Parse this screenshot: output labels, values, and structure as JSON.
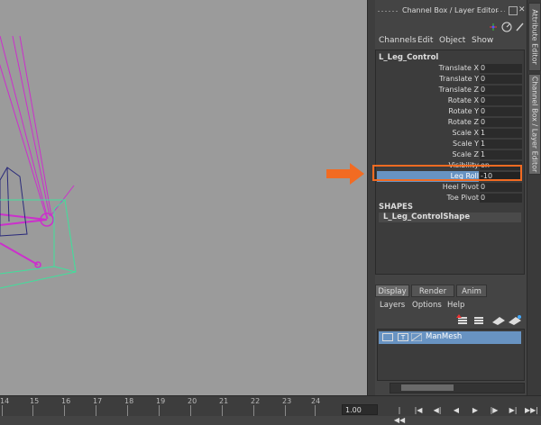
{
  "channel_box": {
    "title": "Channel Box / Layer Editor",
    "menu": [
      "Channels",
      "Edit",
      "Object",
      "Show"
    ],
    "object_name": "L_Leg_Control",
    "attributes": [
      {
        "label": "Translate X",
        "value": "0"
      },
      {
        "label": "Translate Y",
        "value": "0"
      },
      {
        "label": "Translate Z",
        "value": "0"
      },
      {
        "label": "Rotate X",
        "value": "0"
      },
      {
        "label": "Rotate Y",
        "value": "0"
      },
      {
        "label": "Rotate Z",
        "value": "0"
      },
      {
        "label": "Scale X",
        "value": "1"
      },
      {
        "label": "Scale Y",
        "value": "1"
      },
      {
        "label": "Scale Z",
        "value": "1"
      },
      {
        "label": "Visibility",
        "value": "on"
      },
      {
        "label": "Leg Roll",
        "value": "-10",
        "selected": true
      },
      {
        "label": "Heel Pivot",
        "value": "0"
      },
      {
        "label": "Toe Pivot",
        "value": "0"
      }
    ],
    "shapes_header": "SHAPES",
    "shape_name": "L_Leg_ControlShape"
  },
  "side_tabs": [
    "Attribute Editor",
    "Channel Box / Layer Editor"
  ],
  "layer_editor": {
    "tabs": [
      "Display",
      "Render",
      "Anim"
    ],
    "active_tab": "Display",
    "menu": [
      "Layers",
      "Options",
      "Help"
    ],
    "layer": {
      "visible_flag": "",
      "type_flag": "T",
      "name": "ManMesh"
    }
  },
  "timeline": {
    "ticks": [
      "14",
      "15",
      "16",
      "17",
      "18",
      "19",
      "20",
      "21",
      "22",
      "23",
      "24"
    ],
    "current_time": "1.00"
  },
  "colors": {
    "highlight": "#6893c2",
    "callout": "#f26b22",
    "viewport": "#9b9b9b",
    "rig_magenta": "#cc2fcc",
    "rig_green": "#3fe09b",
    "rig_navy": "#2a2a7a"
  }
}
